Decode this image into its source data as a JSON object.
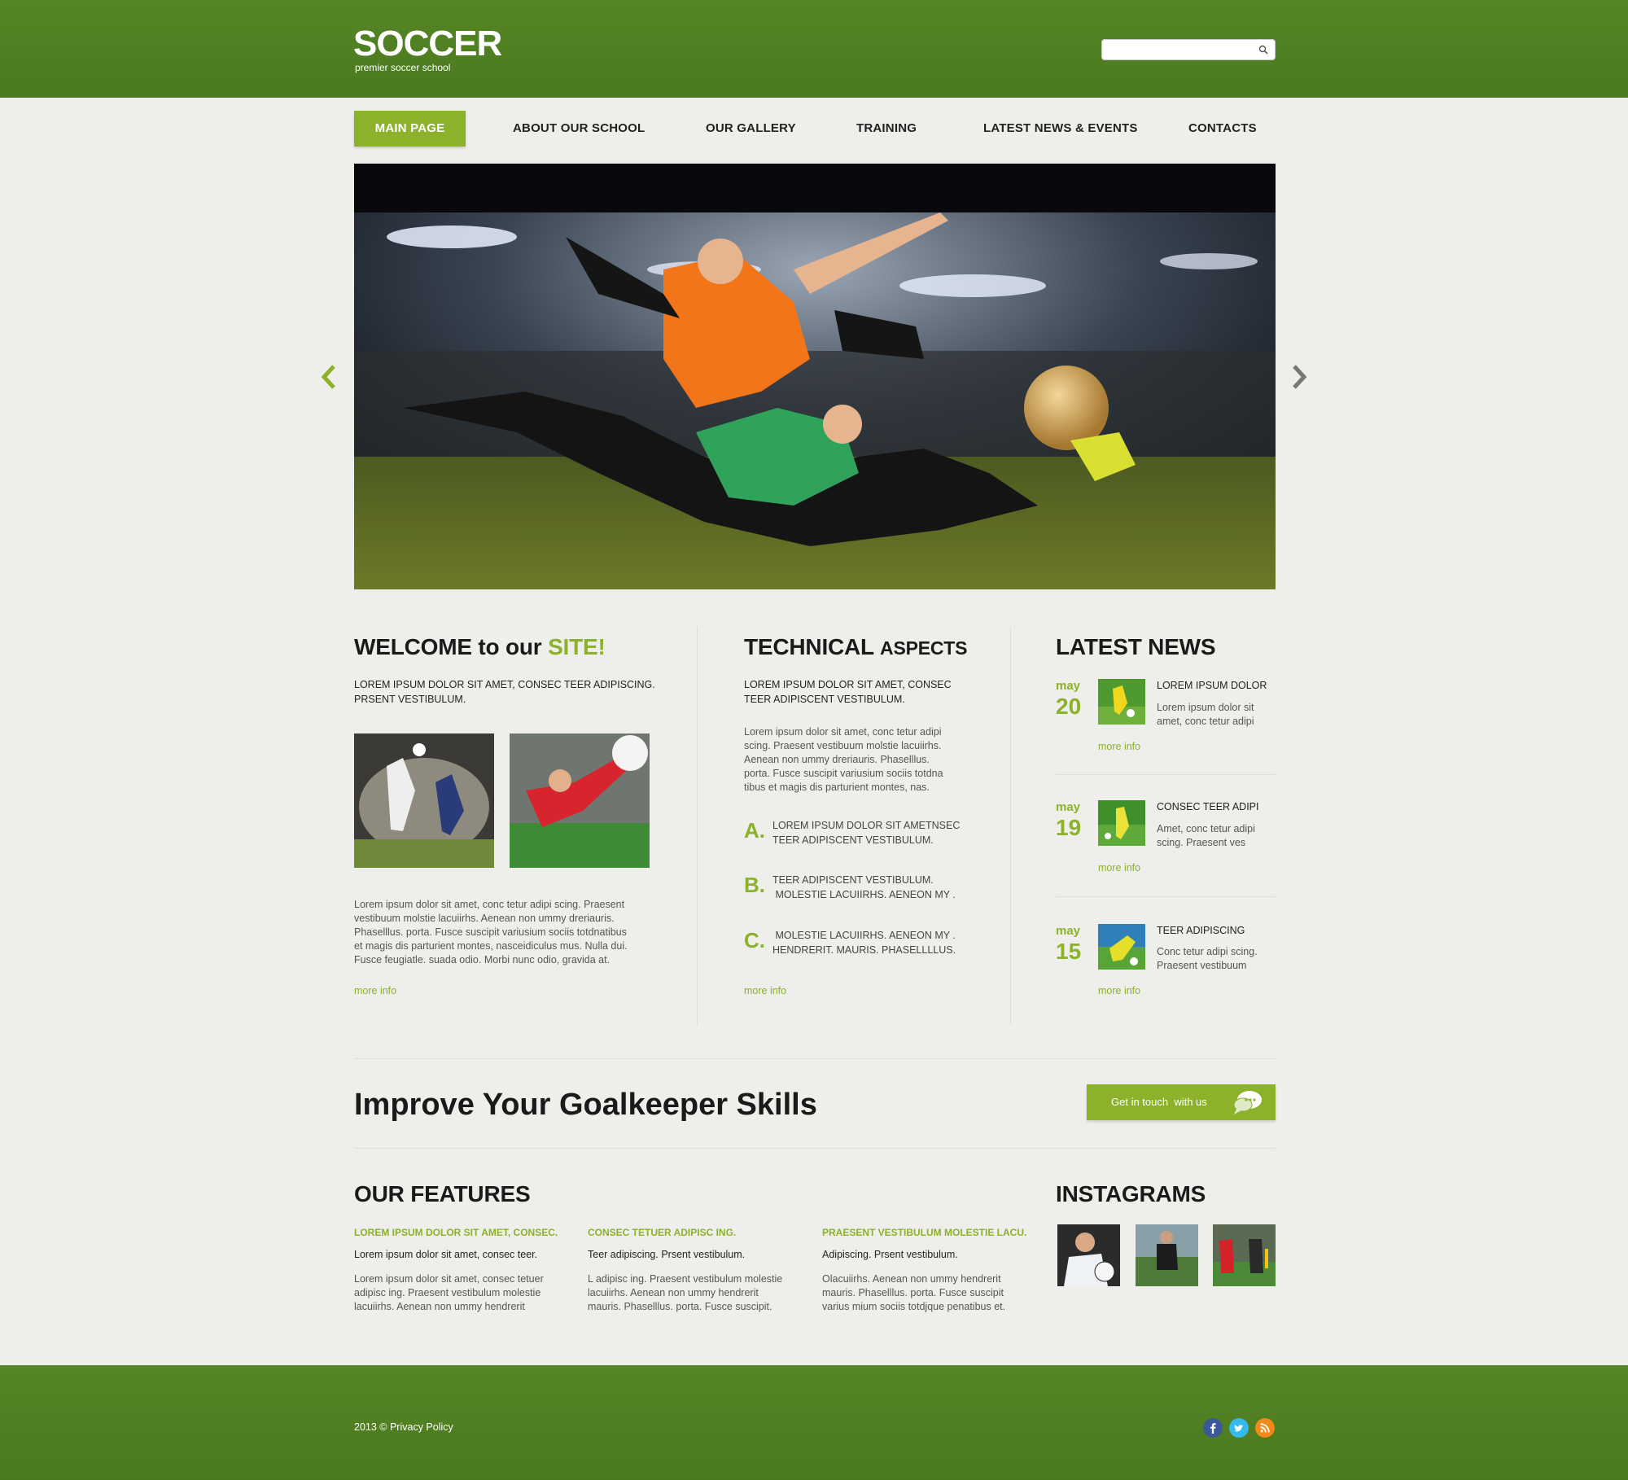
{
  "header": {
    "logo": "SOCCER",
    "tagline": "premier soccer school",
    "search_placeholder": ""
  },
  "nav": {
    "items": [
      {
        "label": "MAIN PAGE",
        "active": true
      },
      {
        "label": "ABOUT OUR SCHOOL"
      },
      {
        "label": "OUR GALLERY"
      },
      {
        "label": "TRAINING"
      },
      {
        "label": "LATEST NEWS & EVENTS"
      },
      {
        "label": "CONTACTS"
      }
    ]
  },
  "welcome": {
    "title_a": "WELCOME to our ",
    "title_b": "SITE!",
    "intro_1": "LOREM IPSUM DOLOR SIT AMET, CONSEC TEER ADIPISCING.",
    "intro_2": "PRSENT VESTIBULUM.",
    "body": [
      "Lorem ipsum dolor sit amet, conc tetur adipi scing. Praesent",
      "vestibuum molstie lacuiirhs. Aenean non ummy dreriauris.",
      "Phaselllus. porta. Fusce suscipit variusium sociis totdnatibus",
      "et magis dis parturient montes, nasceidiculus mus. Nulla dui.",
      "Fusce feugiatle. suada odio. Morbi nunc odio, gravida at."
    ],
    "more": "more info"
  },
  "technical": {
    "title_a": "TECHNICAL ",
    "title_b": "ASPECTS",
    "intro_1": "LOREM IPSUM DOLOR SIT AMET, CONSEC",
    "intro_2": "TEER ADIPISCENT VESTIBULUM.",
    "body": [
      "Lorem ipsum dolor sit amet, conc tetur adipi",
      "scing. Praesent vestibuum molstie lacuiirhs.",
      "Aenean non ummy dreriauris. Phaselllus.",
      "porta. Fusce suscipit variusium sociis totdna",
      "tibus et magis dis parturient montes, nas."
    ],
    "items": [
      {
        "letter": "A.",
        "line1": "LOREM IPSUM DOLOR SIT AMETNSEC",
        "line2": "TEER ADIPISCENT VESTIBULUM."
      },
      {
        "letter": "B.",
        "line1": "TEER ADIPISCENT VESTIBULUM.",
        "line2": " MOLESTIE LACUIIRHS. AENEON MY ."
      },
      {
        "letter": "C.",
        "line1": " MOLESTIE LACUIIRHS. AENEON MY .",
        "line2": "HENDRERIT. MAURIS. PHASELLLLUS."
      }
    ],
    "more": "more info"
  },
  "news": {
    "title": "LATEST NEWS",
    "items": [
      {
        "month": "may",
        "day": "20",
        "title": "LOREM IPSUM DOLOR",
        "text1": "Lorem ipsum dolor sit",
        "text2": "amet, conc tetur adipi",
        "more": "more info"
      },
      {
        "month": "may",
        "day": "19",
        "title": "CONSEC TEER ADIPI",
        "text1": "Amet, conc tetur adipi",
        "text2": "scing. Praesent ves",
        "more": "more info"
      },
      {
        "month": "may",
        "day": "15",
        "title": "TEER ADIPISCING",
        "text1": "Conc tetur adipi scing.",
        "text2": "Praesent vestibuum",
        "more": "more info"
      }
    ]
  },
  "banner": {
    "headline": "Improve Your Goalkeeper Skills",
    "cta": "Get in touch  with us"
  },
  "features": {
    "title": "OUR FEATURES",
    "items": [
      {
        "head": "LOREM IPSUM DOLOR SIT AMET, CONSEC.",
        "sub": "Lorem ipsum dolor sit amet, consec teer.",
        "l1": "Lorem ipsum dolor sit amet, consec tetuer",
        "l2": "adipisc ing. Praesent vestibulum molestie",
        "l3": "lacuiirhs. Aenean non ummy hendrerit"
      },
      {
        "head": "CONSEC TETUER ADIPISC ING.",
        "sub": "Teer adipiscing. Prsent vestibulum.",
        "l1": "L adipisc ing. Praesent vestibulum molestie",
        "l2": "lacuiirhs. Aenean non ummy hendrerit",
        "l3": "mauris. Phaselllus. porta. Fusce suscipit."
      },
      {
        "head": "PRAESENT VESTIBULUM MOLESTIE LACU.",
        "sub": "Adipiscing. Prsent vestibulum.",
        "l1": "Olacuiirhs. Aenean non ummy hendrerit",
        "l2": "mauris. Phaselllus. porta. Fusce suscipit",
        "l3": "varius mium sociis totdjque penatibus et."
      }
    ]
  },
  "instagrams": {
    "title": "INSTAGRAMS"
  },
  "footer": {
    "copyright": "2013 © Privacy Policy"
  },
  "colors": {
    "green_dark": "#4d7a20",
    "accent": "#8bb22a",
    "facebook": "#3b5998",
    "twitter": "#33bbee",
    "rss": "#f28a1b"
  }
}
